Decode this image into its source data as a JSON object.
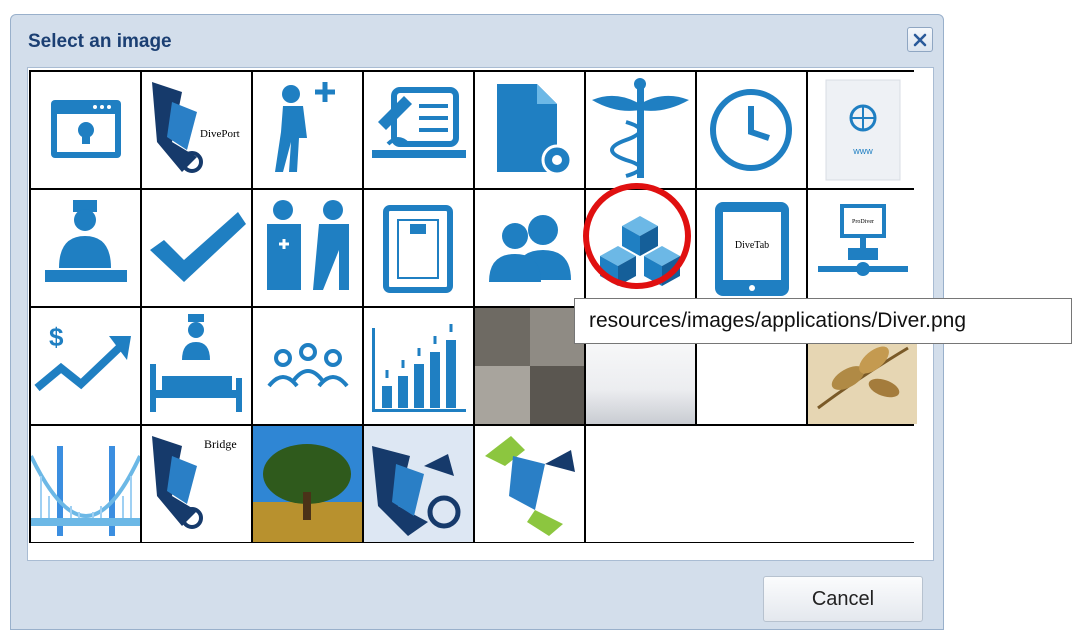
{
  "dialog": {
    "title": "Select an image",
    "close_icon": "close-x-icon",
    "cancel_label": "Cancel"
  },
  "tooltip": {
    "text": "resources/images/applications/Diver.png"
  },
  "images": {
    "diveport_label": "DivePort",
    "divetab_label": "DiveTab",
    "prodiver_label": "ProDiver",
    "bridge_label": "Bridge",
    "web_label": "www"
  },
  "colors": {
    "icon_blue": "#1f7fc2",
    "icon_light": "#6cb8e6",
    "highlight_ring": "#e01010",
    "dialog_bg": "#d3deeb"
  }
}
